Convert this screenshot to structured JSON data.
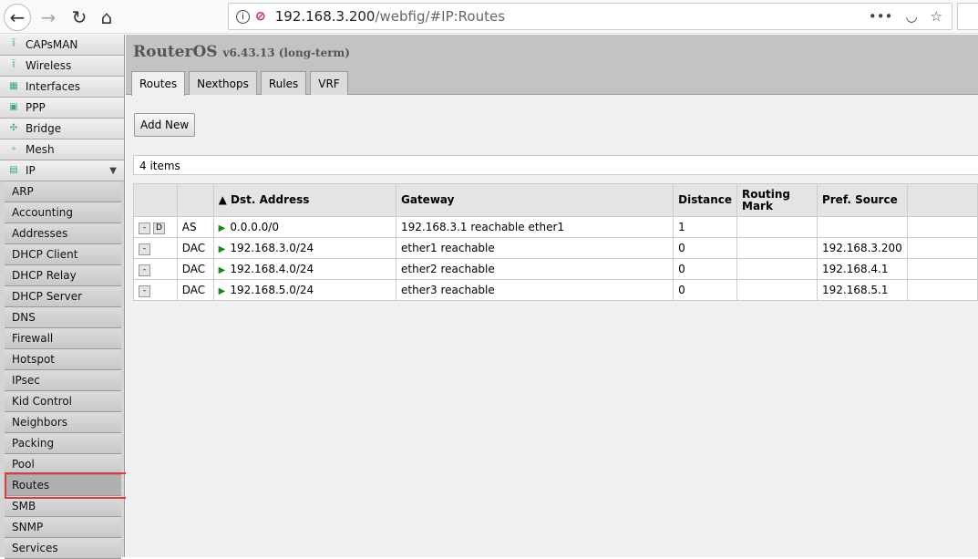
{
  "browser": {
    "url_host": "192.168.3.200",
    "url_path": "/webfig/#IP:Routes",
    "icons": [
      "back-icon",
      "forward-icon",
      "reload-icon",
      "home-icon",
      "info-icon",
      "insecure-icon",
      "more-icon",
      "pocket-icon",
      "bookmark-star-icon",
      "search-icon"
    ]
  },
  "sidebar": {
    "items": [
      {
        "label": "CAPsMAN",
        "icon": "antenna-icon"
      },
      {
        "label": "Wireless",
        "icon": "antenna-icon"
      },
      {
        "label": "Interfaces",
        "icon": "interfaces-icon"
      },
      {
        "label": "PPP",
        "icon": "ppp-icon"
      },
      {
        "label": "Bridge",
        "icon": "bridge-icon"
      },
      {
        "label": "Mesh",
        "icon": "mesh-icon"
      },
      {
        "label": "IP",
        "icon": "ip-icon"
      }
    ],
    "ip_submenu": [
      "ARP",
      "Accounting",
      "Addresses",
      "DHCP Client",
      "DHCP Relay",
      "DHCP Server",
      "DNS",
      "Firewall",
      "Hotspot",
      "IPsec",
      "Kid Control",
      "Neighbors",
      "Packing",
      "Pool",
      "Routes",
      "SMB",
      "SNMP",
      "Services"
    ],
    "selected": "Routes"
  },
  "header": {
    "product": "RouterOS",
    "version": "v6.43.13 (long-term)"
  },
  "tabs": [
    "Routes",
    "Nexthops",
    "Rules",
    "VRF"
  ],
  "toolbar": {
    "add_new": "Add New"
  },
  "items_count": "4 items",
  "table": {
    "columns": [
      "",
      "",
      "▲ Dst. Address",
      "Gateway",
      "Distance",
      "Routing Mark",
      "Pref. Source",
      ""
    ],
    "rows": [
      {
        "remove": "-",
        "disable": "D",
        "flags": "AS",
        "dst": "0.0.0.0/0",
        "gateway": "192.168.3.1 reachable ether1",
        "distance": "1",
        "mark": "",
        "pref_src": ""
      },
      {
        "remove": "-",
        "flags": "DAC",
        "dst": "192.168.3.0/24",
        "gateway": "ether1 reachable",
        "distance": "0",
        "mark": "",
        "pref_src": "192.168.3.200"
      },
      {
        "remove": "-",
        "flags": "DAC",
        "dst": "192.168.4.0/24",
        "gateway": "ether2 reachable",
        "distance": "0",
        "mark": "",
        "pref_src": "192.168.4.1"
      },
      {
        "remove": "-",
        "flags": "DAC",
        "dst": "192.168.5.0/24",
        "gateway": "ether3 reachable",
        "distance": "0",
        "mark": "",
        "pref_src": "192.168.5.1"
      }
    ]
  },
  "colors": {
    "highlight_box": "#e0383e",
    "flag": "#1a8a1a"
  }
}
